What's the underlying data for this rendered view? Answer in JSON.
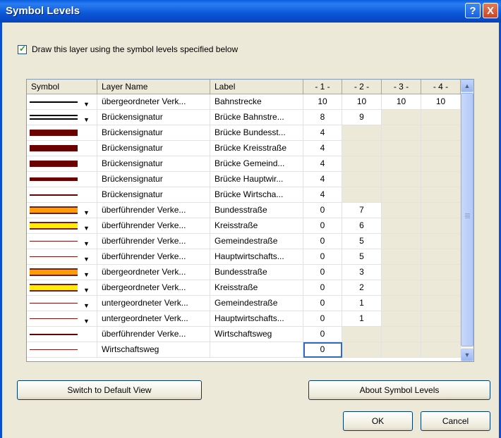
{
  "window": {
    "title": "Symbol Levels",
    "help_glyph": "?",
    "close_glyph": "X"
  },
  "option": {
    "checked": true,
    "label": "Draw this layer using the symbol levels specified below"
  },
  "grid": {
    "columns": [
      "Symbol",
      "Layer Name",
      "Label",
      "- 1 -",
      "- 2 -",
      "- 3 -",
      "- 4 -"
    ],
    "rows": [
      {
        "symbol": {
          "type": "line-black",
          "dropdown": true
        },
        "layer": "übergeordneter Verk...",
        "label": "Bahnstrecke",
        "levels": [
          "10",
          "10",
          "10",
          "10"
        ]
      },
      {
        "symbol": {
          "type": "double-line",
          "dropdown": true
        },
        "layer": "Brückensignatur",
        "label": "Brücke Bahnstre...",
        "levels": [
          "8",
          "9",
          "",
          ""
        ]
      },
      {
        "symbol": {
          "type": "thick-brown",
          "dropdown": false
        },
        "layer": "Brückensignatur",
        "label": "Brücke Bundesst...",
        "levels": [
          "4",
          "",
          "",
          ""
        ]
      },
      {
        "symbol": {
          "type": "thick-brown",
          "dropdown": false
        },
        "layer": "Brückensignatur",
        "label": "Brücke Kreisstraße",
        "levels": [
          "4",
          "",
          "",
          ""
        ]
      },
      {
        "symbol": {
          "type": "thick-brown",
          "dropdown": false
        },
        "layer": "Brückensignatur",
        "label": "Brücke Gemeind...",
        "levels": [
          "4",
          "",
          "",
          ""
        ]
      },
      {
        "symbol": {
          "type": "medium-brown",
          "dropdown": false
        },
        "layer": "Brückensignatur",
        "label": "Brücke Hauptwir...",
        "levels": [
          "4",
          "",
          "",
          ""
        ]
      },
      {
        "symbol": {
          "type": "thin-brown",
          "dropdown": false
        },
        "layer": "Brückensignatur",
        "label": "Brücke Wirtscha...",
        "levels": [
          "4",
          "",
          "",
          ""
        ]
      },
      {
        "symbol": {
          "type": "orange-road",
          "dropdown": true
        },
        "layer": "überführender Verke...",
        "label": "Bundesstraße",
        "levels": [
          "0",
          "7",
          "",
          ""
        ]
      },
      {
        "symbol": {
          "type": "yellow-road",
          "dropdown": true
        },
        "layer": "überführender Verke...",
        "label": "Kreisstraße",
        "levels": [
          "0",
          "6",
          "",
          ""
        ]
      },
      {
        "symbol": {
          "type": "thin-red",
          "dropdown": true
        },
        "layer": "überführender Verke...",
        "label": "Gemeindestraße",
        "levels": [
          "0",
          "5",
          "",
          ""
        ]
      },
      {
        "symbol": {
          "type": "thin-red",
          "dropdown": true
        },
        "layer": "überführender Verke...",
        "label": "Hauptwirtschafts...",
        "levels": [
          "0",
          "5",
          "",
          ""
        ]
      },
      {
        "symbol": {
          "type": "orange-road",
          "dropdown": true
        },
        "layer": "übergeordneter Verk...",
        "label": "Bundesstraße",
        "levels": [
          "0",
          "3",
          "",
          ""
        ]
      },
      {
        "symbol": {
          "type": "yellow-road",
          "dropdown": true
        },
        "layer": "übergeordneter Verk...",
        "label": "Kreisstraße",
        "levels": [
          "0",
          "2",
          "",
          ""
        ]
      },
      {
        "symbol": {
          "type": "thin-red",
          "dropdown": true
        },
        "layer": "untergeordneter Verk...",
        "label": "Gemeindestraße",
        "levels": [
          "0",
          "1",
          "",
          ""
        ]
      },
      {
        "symbol": {
          "type": "thin-red",
          "dropdown": true
        },
        "layer": "untergeordneter Verk...",
        "label": "Hauptwirtschafts...",
        "levels": [
          "0",
          "1",
          "",
          ""
        ]
      },
      {
        "symbol": {
          "type": "thin-brown",
          "dropdown": false
        },
        "layer": "überführender Verke...",
        "label": "Wirtschaftsweg",
        "levels": [
          "0",
          "",
          "",
          ""
        ]
      },
      {
        "symbol": {
          "type": "thin-red",
          "dropdown": false
        },
        "layer": "Wirtschaftsweg",
        "label": "",
        "levels": [
          "0",
          "",
          "",
          ""
        ]
      }
    ]
  },
  "buttons": {
    "default_view": "Switch to Default View",
    "about": "About Symbol Levels",
    "ok": "OK",
    "cancel": "Cancel"
  },
  "scrollbar": {
    "up_glyph": "▲",
    "down_glyph": "▼"
  }
}
